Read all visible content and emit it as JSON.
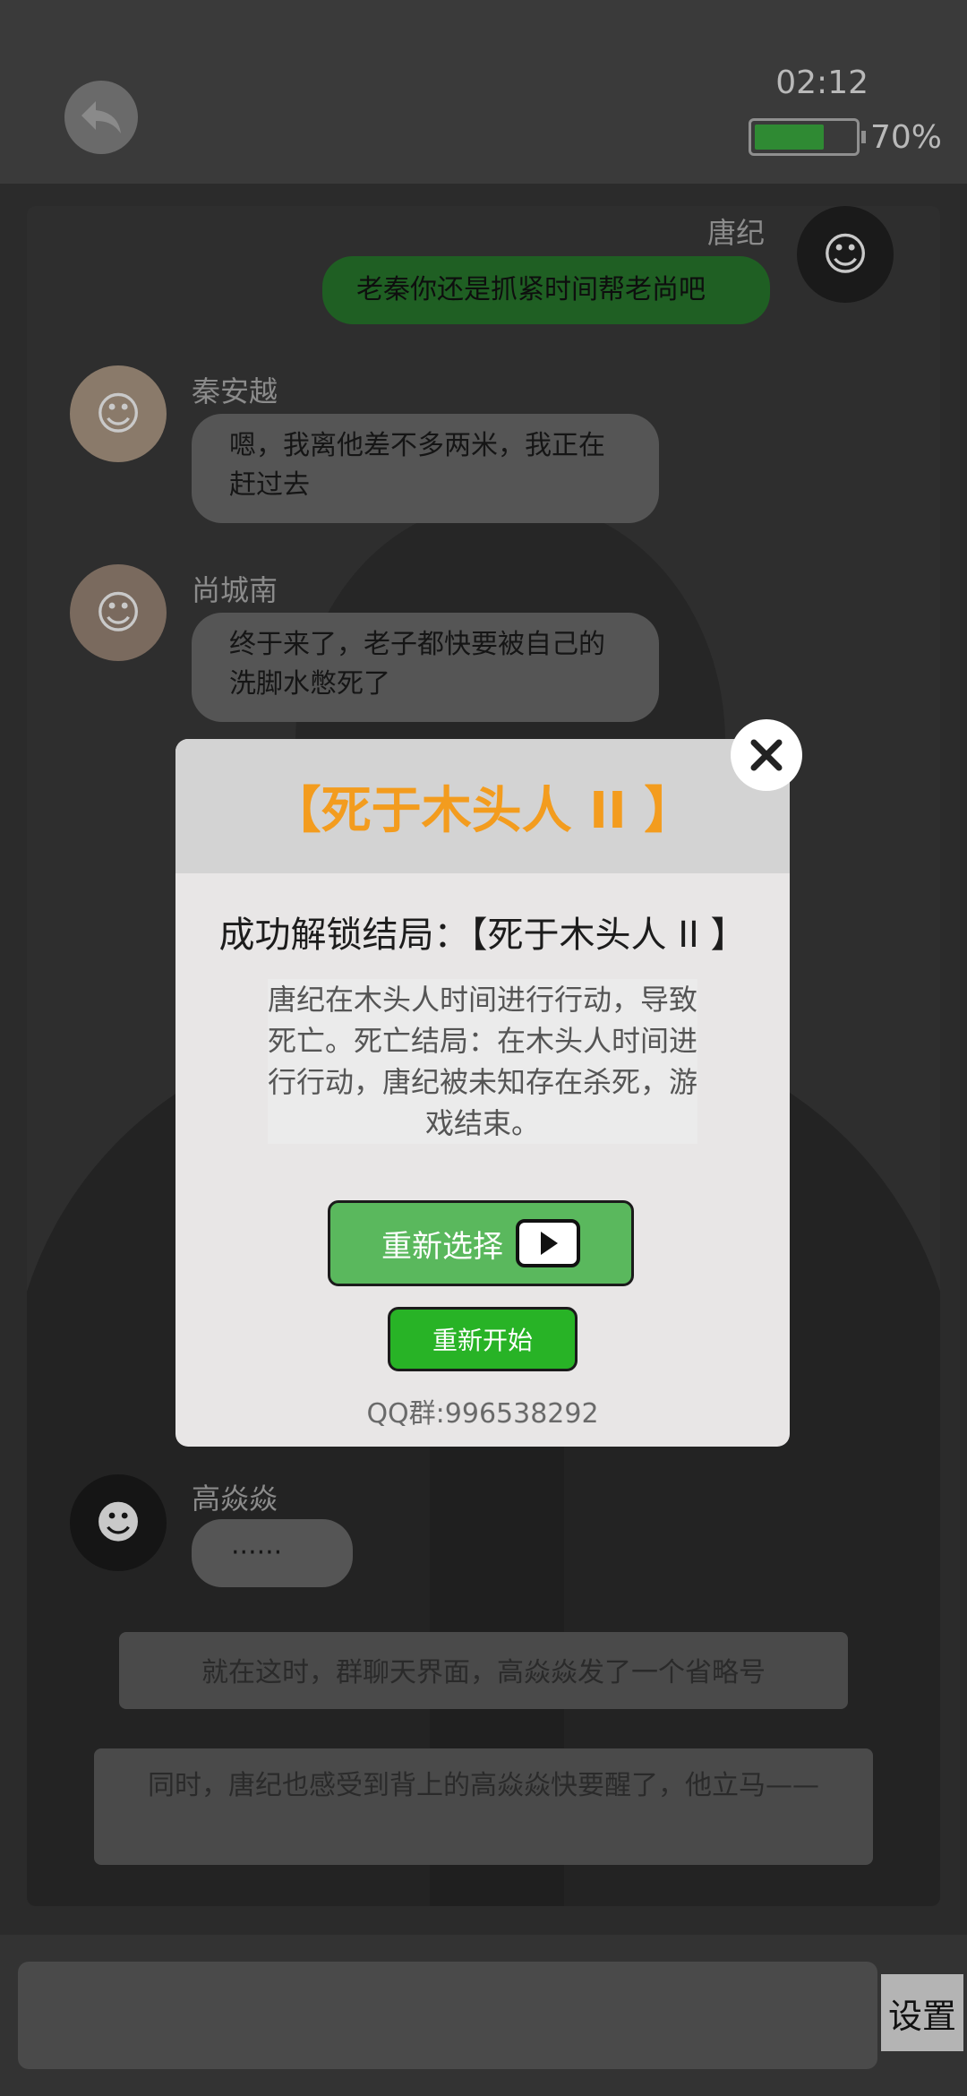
{
  "header": {
    "time": "02:12",
    "battery_percent": 70,
    "battery_label": "70%"
  },
  "messages": [
    {
      "sender": "唐纪",
      "text": "老秦你还是抓紧时间帮老尚吧",
      "side": "right"
    },
    {
      "sender": "秦安越",
      "text": "嗯，我离他差不多两米，我正在赶过去",
      "side": "left"
    },
    {
      "sender": "尚城南",
      "text": "终于来了，老子都快要被自己的洗脚水憋死了",
      "side": "left"
    },
    {
      "sender": "高焱焱",
      "text": "······",
      "side": "left"
    }
  ],
  "narrations": [
    "就在这时，群聊天界面，高焱焱发了一个省略号",
    "同时，唐纪也感受到背上的高焱焱快要醒了，他立马——"
  ],
  "modal": {
    "title": "【死于木头人 II 】",
    "unlock_text": "成功解锁结局：【死于木头人 II 】",
    "description": "唐纪在木头人时间进行行动，导致死亡。死亡结局：在木头人时间进行行动，唐纪被未知存在杀死，游戏结束。",
    "reselect_label": "重新选择",
    "restart_label": "重新开始",
    "qq_text": "QQ群:996538292"
  },
  "footer": {
    "input_value": "",
    "settings_label": "设置"
  },
  "colors": {
    "accent_orange": "#f39c1e",
    "green_button": "#5ab85d",
    "restart_green": "#28b326"
  }
}
